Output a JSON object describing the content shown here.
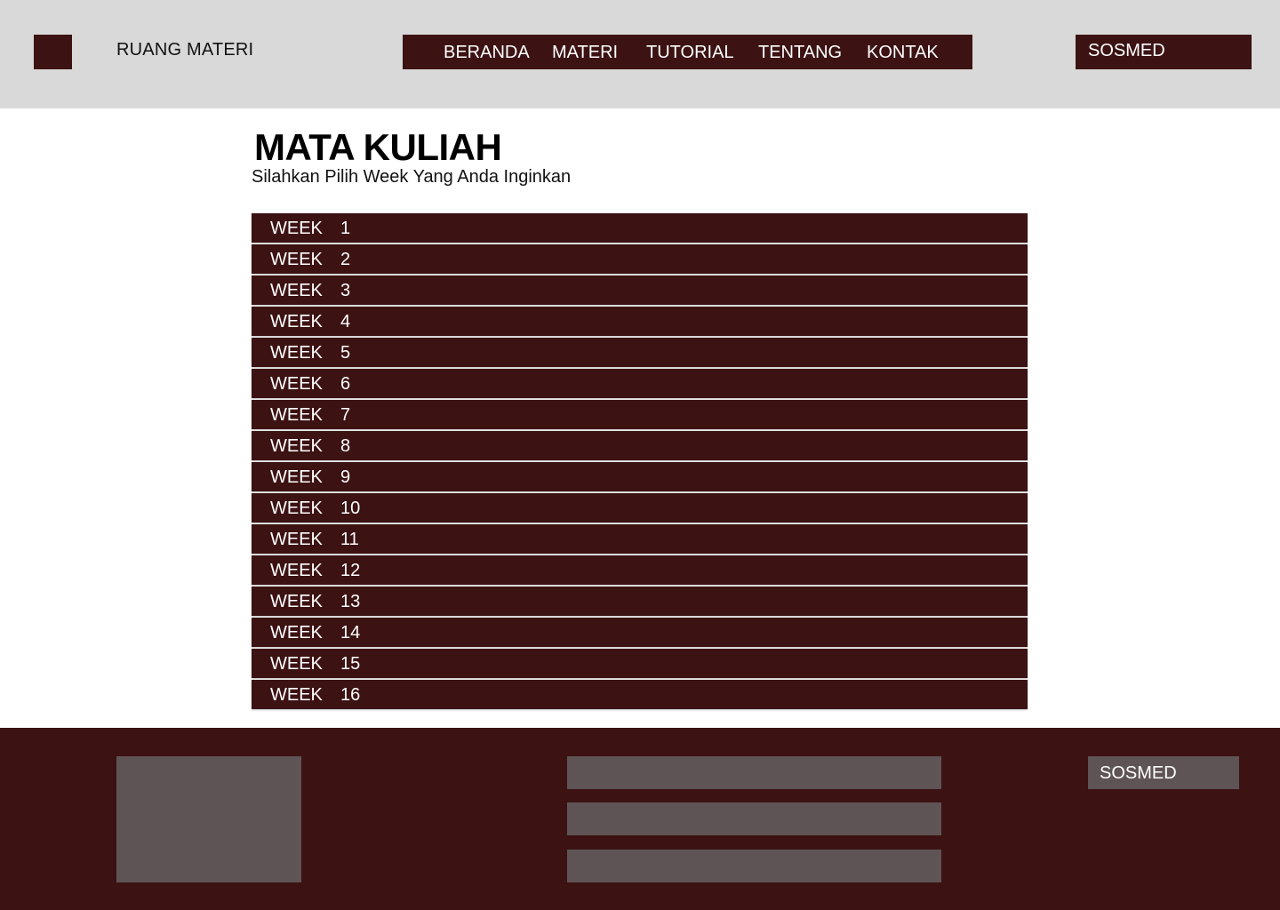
{
  "header": {
    "brand": "RUANG MATERI",
    "nav": [
      "BERANDA",
      "MATERI",
      "TUTORIAL",
      "TENTANG",
      "KONTAK"
    ],
    "sosmed": "SOSMED"
  },
  "main": {
    "title": "MATA KULIAH",
    "subtitle": "Silahkan Pilih Week Yang Anda Inginkan",
    "weeks": [
      {
        "label": "WEEK",
        "num": "1"
      },
      {
        "label": "WEEK",
        "num": "2"
      },
      {
        "label": "WEEK",
        "num": "3"
      },
      {
        "label": "WEEK",
        "num": "4"
      },
      {
        "label": "WEEK",
        "num": "5"
      },
      {
        "label": "WEEK",
        "num": "6"
      },
      {
        "label": "WEEK",
        "num": "7"
      },
      {
        "label": "WEEK",
        "num": "8"
      },
      {
        "label": "WEEK",
        "num": "9"
      },
      {
        "label": "WEEK",
        "num": "10"
      },
      {
        "label": "WEEK",
        "num": "11"
      },
      {
        "label": "WEEK",
        "num": "12"
      },
      {
        "label": "WEEK",
        "num": "13"
      },
      {
        "label": "WEEK",
        "num": "14"
      },
      {
        "label": "WEEK",
        "num": "15"
      },
      {
        "label": "WEEK",
        "num": "16"
      }
    ]
  },
  "footer": {
    "sosmed": "SOSMED"
  },
  "colors": {
    "primary": "#3c1213",
    "header_bg": "#d9d9d9",
    "placeholder": "#5f5455"
  }
}
